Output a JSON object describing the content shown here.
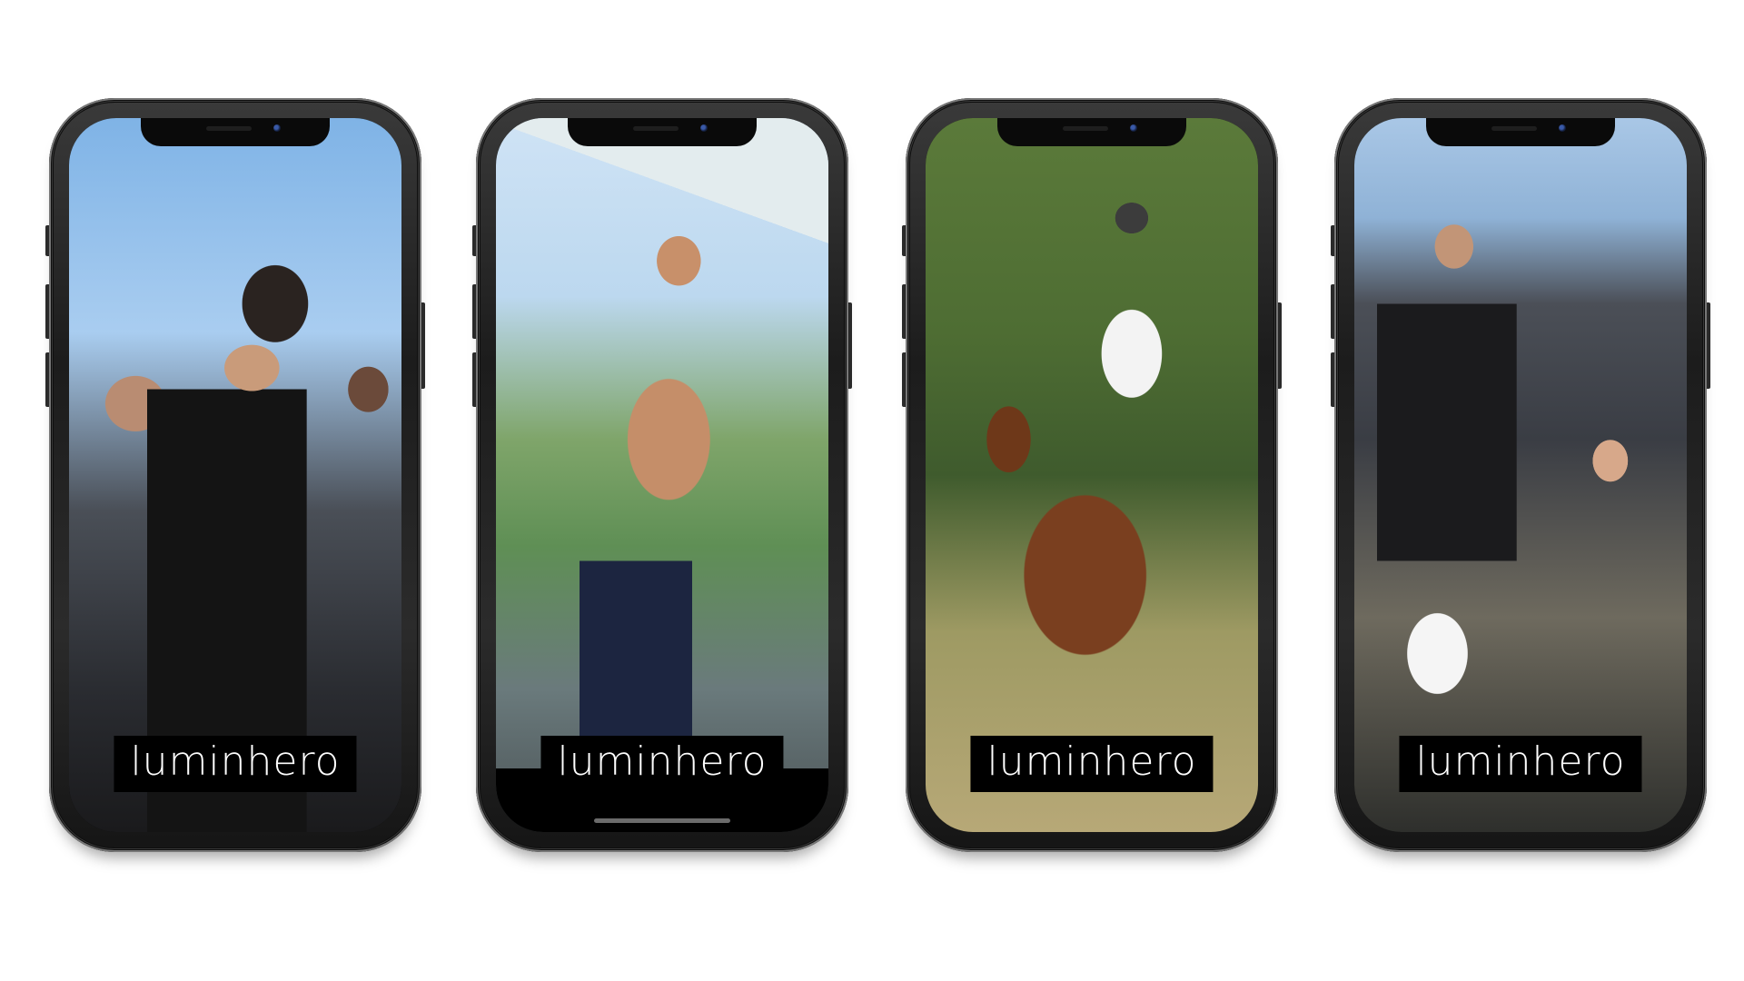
{
  "phones": [
    {
      "caption": "luminhero",
      "scene_icon": "crowd-photo"
    },
    {
      "caption": "luminhero",
      "scene_icon": "flexing-man-photo"
    },
    {
      "caption": "luminhero",
      "scene_icon": "polo-rider-photo"
    },
    {
      "caption": "luminhero",
      "scene_icon": "fitness-class-photo"
    }
  ],
  "colors": {
    "caption_bg": "#000000",
    "caption_text": "#ffffff",
    "page_bg": "#ffffff",
    "phone_frame": "#1c1c1c"
  }
}
